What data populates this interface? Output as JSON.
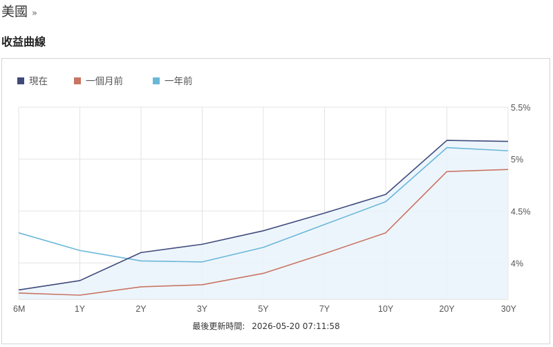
{
  "header": {
    "region": "美國",
    "more": "»"
  },
  "section": {
    "title": "收益曲線"
  },
  "footer": {
    "label": "最後更新時間:",
    "timestamp": "2026-05-20 07:11:58"
  },
  "colors": {
    "current": "#3f4a7b",
    "month_ago": "#c87563",
    "year_ago": "#6ab7d8",
    "fill": "#eaf3fb",
    "grid": "#e3e3e3"
  },
  "chart_data": {
    "type": "line",
    "categories": [
      "6M",
      "1Y",
      "2Y",
      "3Y",
      "5Y",
      "7Y",
      "10Y",
      "20Y",
      "30Y"
    ],
    "ylim": [
      3.65,
      5.5
    ],
    "yticks": [
      4,
      4.5,
      5,
      5.5
    ],
    "ytick_labels": [
      "4%",
      "4.5%",
      "5%",
      "5.5%"
    ],
    "grid": true,
    "legend_position": "top-left",
    "series": [
      {
        "name": "現在",
        "color": "#3f4a7b",
        "values": [
          3.74,
          3.83,
          4.1,
          4.18,
          4.31,
          4.48,
          4.66,
          5.18,
          5.17
        ]
      },
      {
        "name": "一個月前",
        "color": "#c87563",
        "values": [
          3.71,
          3.69,
          3.77,
          3.79,
          3.9,
          4.09,
          4.29,
          4.88,
          4.9
        ]
      },
      {
        "name": "一年前",
        "color": "#6ab7d8",
        "values": [
          4.29,
          4.12,
          4.02,
          4.01,
          4.15,
          4.37,
          4.59,
          5.11,
          5.08
        ]
      }
    ]
  }
}
